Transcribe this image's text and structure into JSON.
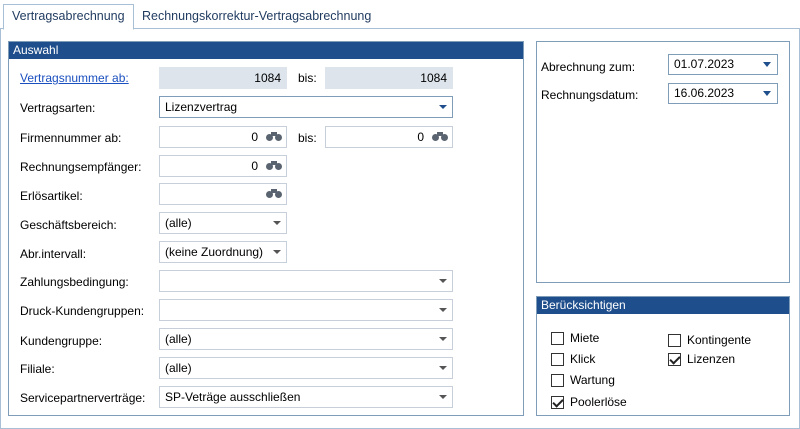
{
  "tabs": [
    {
      "label": "Vertragsabrechnung"
    },
    {
      "label": "Rechnungskorrektur-Vertragsabrechnung"
    }
  ],
  "auswahl": {
    "title": "Auswahl",
    "vertragsnummer_label": "Vertragsnummer ab:",
    "vertragsnummer_from": "1084",
    "bis_label": "bis:",
    "vertragsnummer_to": "1084",
    "vertragsarten_label": "Vertragsarten:",
    "vertragsarten_value": "Lizenzvertrag",
    "firmennummer_label": "Firmennummer ab:",
    "firmennummer_from": "0",
    "firmennummer_to": "0",
    "rechnungsempfaenger_label": "Rechnungsempfänger:",
    "rechnungsempfaenger_value": "0",
    "erloesartikel_label": "Erlösartikel:",
    "erloesartikel_value": "",
    "geschaeftsbereich_label": "Geschäftsbereich:",
    "geschaeftsbereich_value": "(alle)",
    "abrintervall_label": "Abr.intervall:",
    "abrintervall_value": "(keine Zuordnung)",
    "zahlungsbedingung_label": "Zahlungsbedingung:",
    "zahlungsbedingung_value": "",
    "druck_label": "Druck-Kundengruppen:",
    "druck_value": "",
    "kundengruppe_label": "Kundengruppe:",
    "kundengruppe_value": "(alle)",
    "filiale_label": "Filiale:",
    "filiale_value": "(alle)",
    "servicepartner_label": "Servicepartnerverträge:",
    "servicepartner_value": "SP-Veträge ausschließen"
  },
  "dates": {
    "abrechnung_label": "Abrechnung zum:",
    "abrechnung_value": "01.07.2023",
    "rechnungsdatum_label": "Rechnungsdatum:",
    "rechnungsdatum_value": "16.06.2023"
  },
  "beruecksichtigen": {
    "title": "Berücksichtigen",
    "items": [
      {
        "label": "Miete",
        "checked": false
      },
      {
        "label": "Klick",
        "checked": false
      },
      {
        "label": "Wartung",
        "checked": false
      },
      {
        "label": "Poolerlöse",
        "checked": true
      },
      {
        "label": "Kontingente",
        "checked": false
      },
      {
        "label": "Lizenzen",
        "checked": true
      }
    ]
  },
  "colors": {
    "group_header": "#1f4e8c",
    "link": "#1a4fbf",
    "readonly_field": "#dde4ec"
  }
}
